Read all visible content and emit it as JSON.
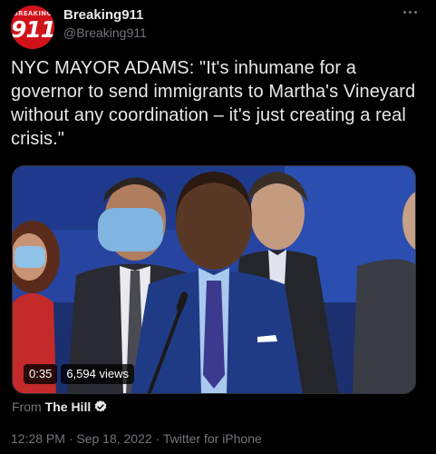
{
  "author": {
    "avatar_top_text": "BREAKING",
    "avatar_number": "911",
    "display_name": "Breaking911",
    "handle": "@Breaking911"
  },
  "tweet": {
    "text": "NYC MAYOR ADAMS: \"It's inhumane for a governor to send immigrants to Martha's Vineyard without any coordination – it's just creating a real crisis.\""
  },
  "video": {
    "duration": "0:35",
    "views": "6,594 views"
  },
  "source": {
    "prefix": "From",
    "name": "The Hill"
  },
  "footer": {
    "timestamp": "12:28 PM · Sep 18, 2022 · Twitter for iPhone"
  },
  "icons": {
    "more": "more-horizontal-icon",
    "verified": "verified-badge-icon"
  },
  "colors": {
    "background": "#000000",
    "text_primary": "#e7e9ea",
    "text_secondary": "#71767b",
    "avatar_red": "#d0121b",
    "verified_fill": "#e7e9ea"
  }
}
